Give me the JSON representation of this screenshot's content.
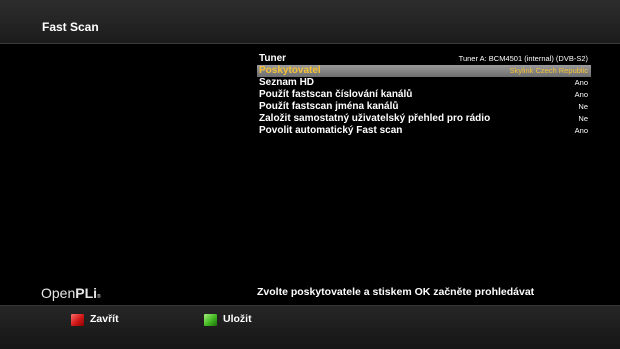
{
  "window": {
    "title": "Fast Scan"
  },
  "config": {
    "items": [
      {
        "label": "Tuner",
        "value": "Tuner A: BCM4501 (internal) (DVB-S2)",
        "selected": false
      },
      {
        "label": "Poskytovatel",
        "value": "Skylink Czech Republic",
        "selected": true
      },
      {
        "label": "Seznam HD",
        "value": "Ano",
        "selected": false
      },
      {
        "label": "Použít fastscan číslování kanálů",
        "value": "Ano",
        "selected": false
      },
      {
        "label": "Použít fastscan jména kanálů",
        "value": "Ne",
        "selected": false
      },
      {
        "label": "Založit samostatný uživatelský přehled pro rádio",
        "value": "Ne",
        "selected": false
      },
      {
        "label": "Povolit automatický Fast scan",
        "value": "Ano",
        "selected": false
      }
    ]
  },
  "logo": {
    "main": "Open",
    "accent": "PLi",
    "mark": "®"
  },
  "help": {
    "text": "Zvolte poskytovatele a stiskem OK začněte prohledávat"
  },
  "buttons": {
    "red": {
      "label": "Zavřít",
      "color": "#d01818",
      "icon": "red-key-icon"
    },
    "green": {
      "label": "Uložit",
      "color": "#42b823",
      "icon": "green-key-icon"
    }
  },
  "colors": {
    "selected_text": "#f6c235",
    "selected_bar": "#8a8a8a"
  }
}
